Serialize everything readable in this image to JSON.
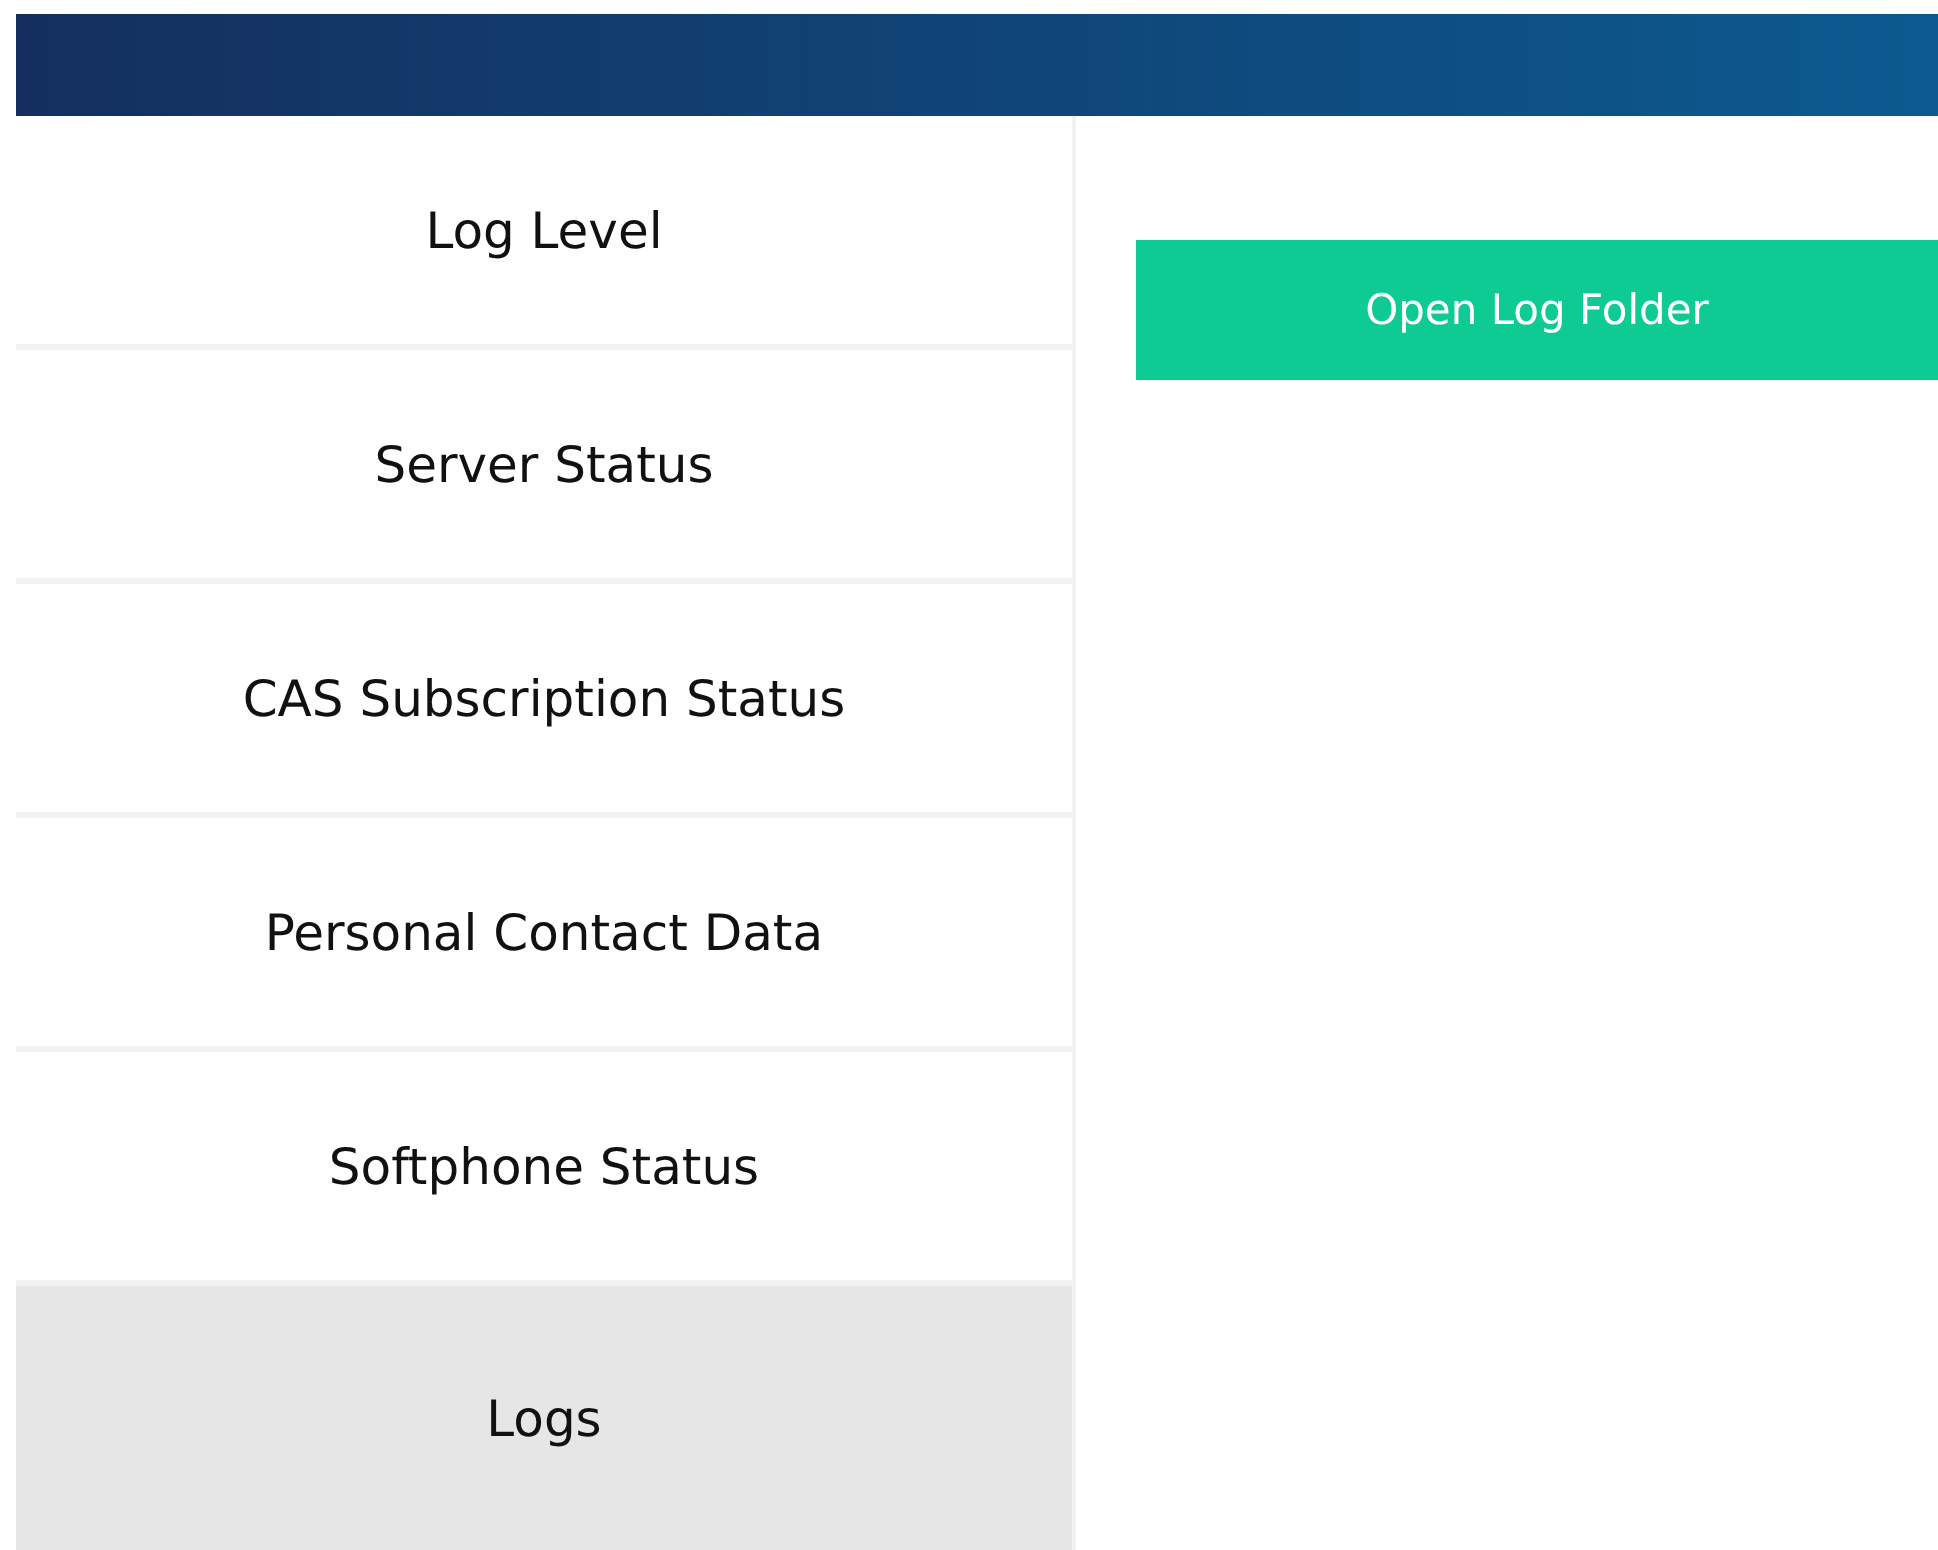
{
  "sidebar": {
    "items": [
      {
        "label": "Log Level",
        "selected": false
      },
      {
        "label": "Server Status",
        "selected": false
      },
      {
        "label": "CAS Subscription Status",
        "selected": false
      },
      {
        "label": "Personal Contact Data",
        "selected": false
      },
      {
        "label": "Softphone Status",
        "selected": false
      },
      {
        "label": "Logs",
        "selected": true
      }
    ]
  },
  "content": {
    "button": "Open Log Folder"
  }
}
